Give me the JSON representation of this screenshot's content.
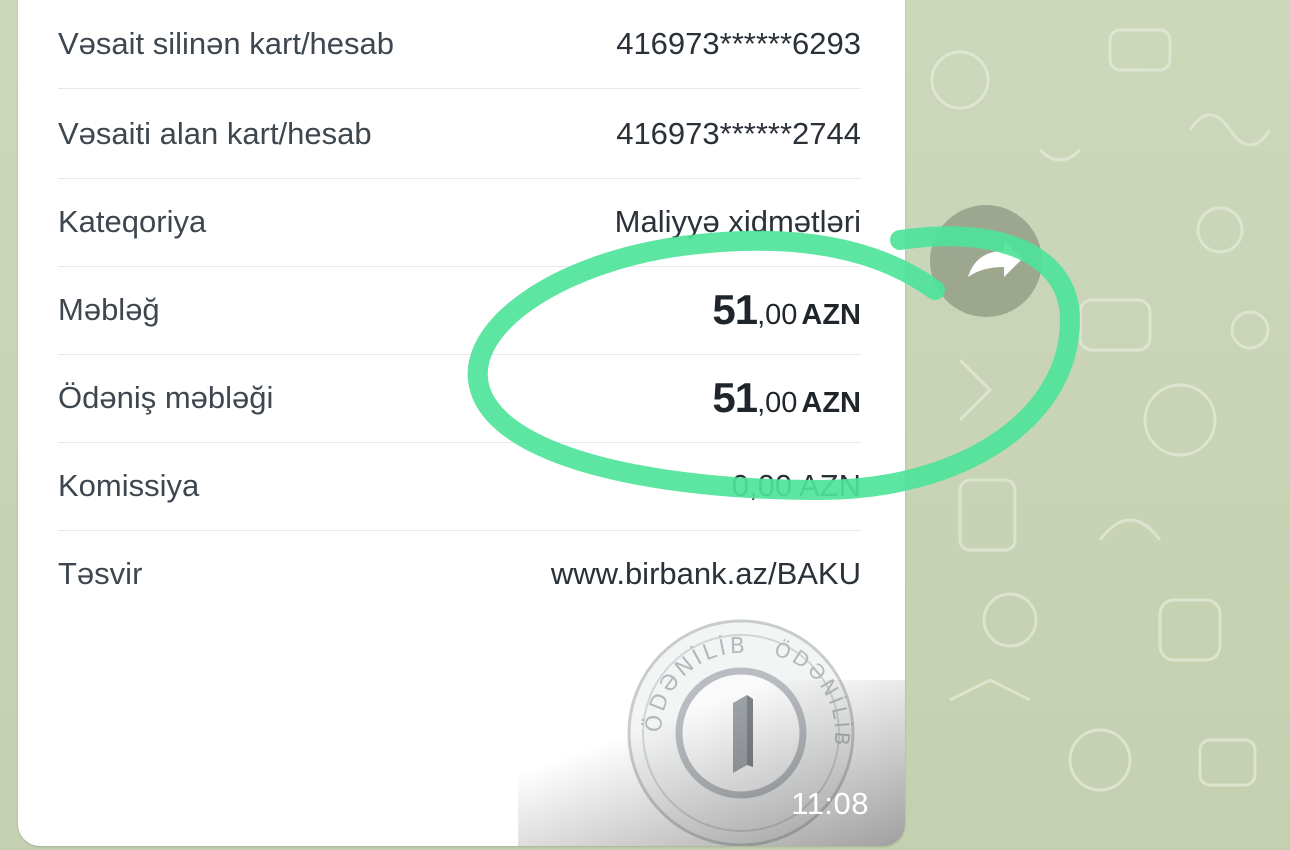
{
  "receipt": {
    "rows": [
      {
        "label": "Vəsait silinən kart/hesab",
        "value": "416973******6293"
      },
      {
        "label": "Vəsaiti alan kart/hesab",
        "value": "416973******2744"
      },
      {
        "label": "Kateqoriya",
        "value": "Maliyyə xidmətləri"
      },
      {
        "label": "Məbləğ",
        "amount_int": "51",
        "amount_dec": ",00",
        "currency": "AZN"
      },
      {
        "label": "Ödəniş məbləği",
        "amount_int": "51",
        "amount_dec": ",00",
        "currency": "AZN"
      },
      {
        "label": "Komissiya",
        "value": "0,00 AZN"
      },
      {
        "label": "Təsvir",
        "value": "www.birbank.az/BAKU"
      }
    ],
    "stamp": {
      "top_text": "ÖDƏNİLİB",
      "side_text": "ÖDƏNİLİB"
    }
  },
  "message": {
    "time": "11:08"
  },
  "colors": {
    "chat_background": "#c9d4b6",
    "bubble": "#ffffff",
    "highlight_marker": "#4fe39a",
    "label_text": "#3e4750"
  },
  "icons": {
    "share": "share-arrow-icon",
    "stamp_logo": "bank-logo-icon"
  }
}
